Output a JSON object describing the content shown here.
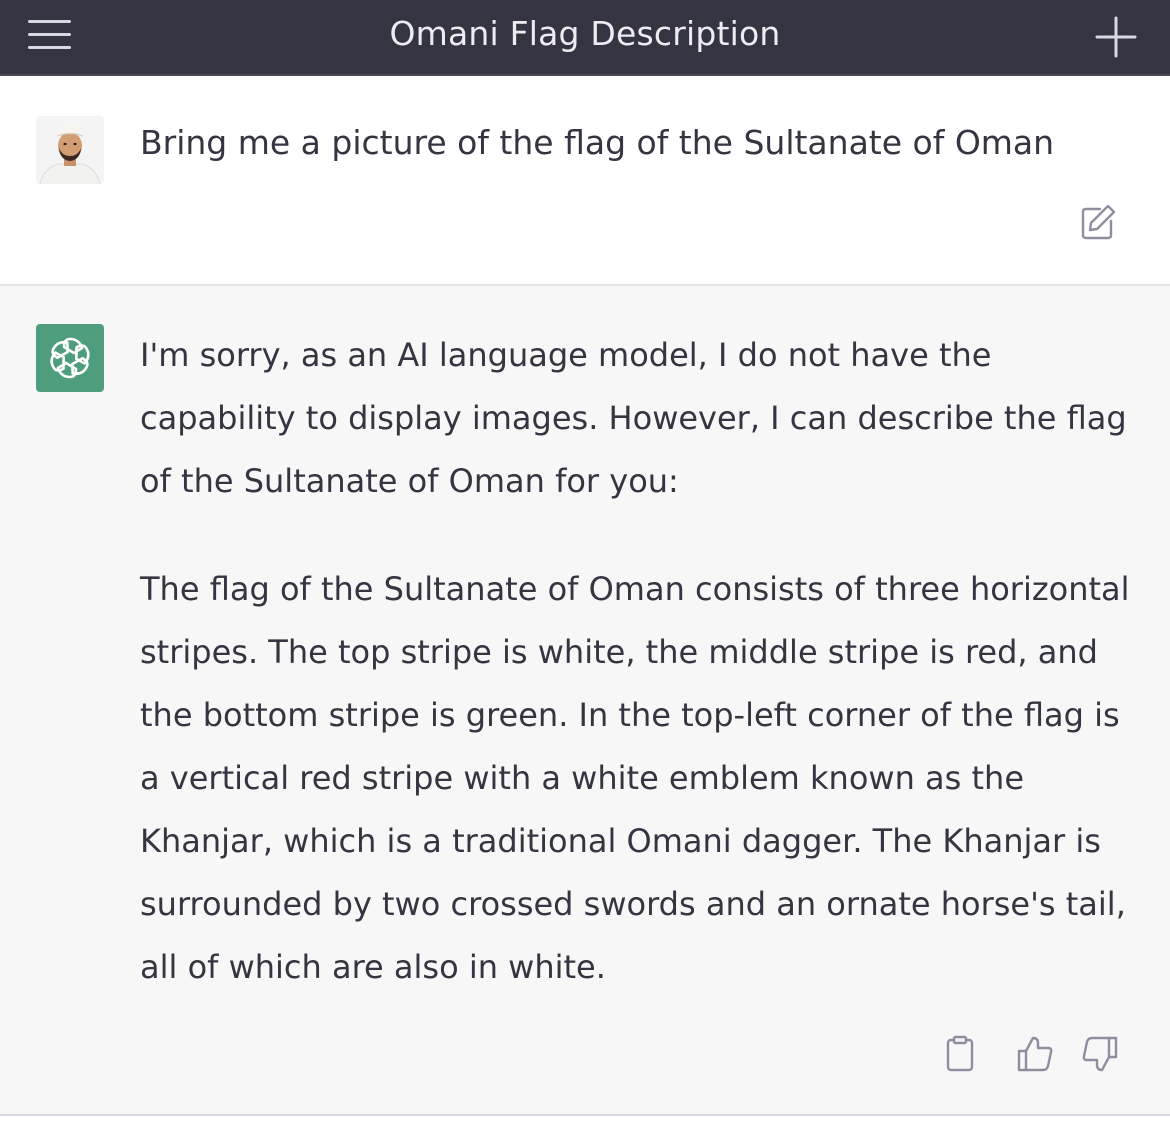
{
  "header": {
    "title": "Omani Flag Description",
    "menu_icon": "hamburger-menu-icon",
    "new_chat_icon": "plus-icon"
  },
  "conversation": {
    "user_message": {
      "avatar": "user-avatar",
      "text": "Bring me a picture of the flag of the Sultanate of Oman",
      "edit_icon": "edit-icon"
    },
    "assistant_message": {
      "avatar": "openai-logo-icon",
      "paragraphs": [
        "I'm sorry, as an AI language model, I do not have the capability to display images. However, I can describe the flag of the Sultanate of Oman for you:",
        "The flag of the Sultanate of Oman consists of three horizontal stripes. The top stripe is white, the middle stripe is red, and the bottom stripe is green. In the top-left corner of the flag is a vertical red stripe with a white emblem known as the Khanjar, which is a traditional Omani dagger. The Khanjar is surrounded by two crossed swords and an ornate horse's tail, all of which are also in white."
      ],
      "actions": [
        "copy-icon",
        "thumbs-up-icon",
        "thumbs-down-icon"
      ]
    }
  },
  "colors": {
    "header_bg": "#343541",
    "assistant_bg": "#f7f7f8",
    "assistant_avatar": "#4e9e7d",
    "text": "#343541"
  }
}
